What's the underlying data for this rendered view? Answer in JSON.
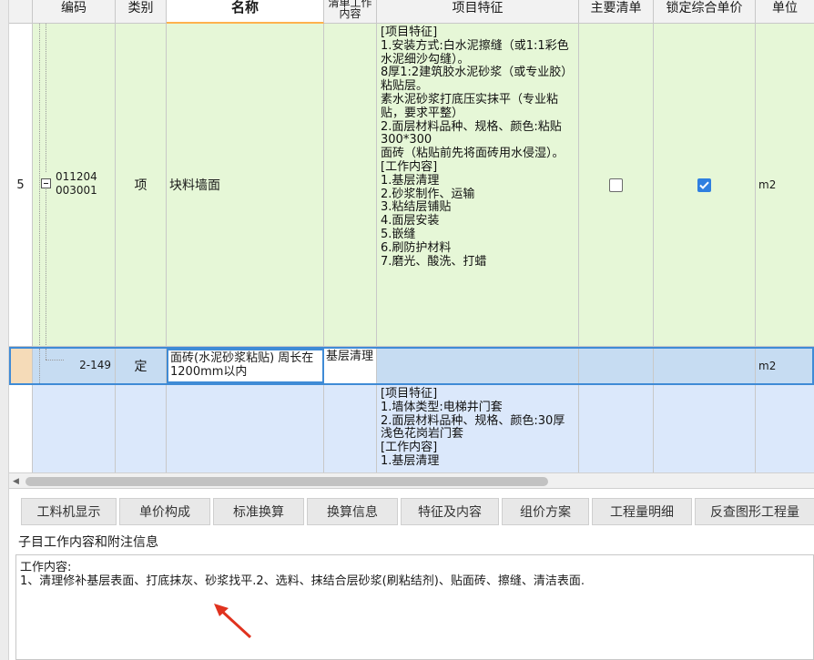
{
  "header": {
    "code": "编码",
    "type": "类别",
    "name": "名称",
    "work_content": "清单工作内容",
    "features": "项目特征",
    "main_item": "主要清单",
    "lock_price": "锁定综合单价",
    "unit": "单位"
  },
  "rows": [
    {
      "num": "5",
      "code_line1": "011204",
      "code_line2": "003001",
      "type": "项",
      "name": "块料墙面",
      "work_content": "",
      "features": "[项目特征]\n1.安装方式:白水泥擦缝（或1:1彩色水泥细沙勾缝）。\n8厚1:2建筑胶水泥砂浆（或专业胶）粘贴层。\n素水泥砂浆打底压实抹平（专业粘贴，要求平整）\n2.面层材料品种、规格、颜色:粘贴300*300\n面砖（粘贴前先将面砖用水侵湿）。\n[工作内容]\n1.基层清理\n2.砂浆制作、运输\n3.粘结层铺贴\n4.面层安装\n5.嵌缝\n6.刷防护材料\n7.磨光、酸洗、打蜡",
      "main_checked": false,
      "lock_checked": true,
      "unit": "m2"
    },
    {
      "num": "",
      "code": "2-149",
      "type": "定",
      "name": "面砖(水泥砂浆粘贴) 周长在1200mm以内",
      "work_content": "基层清理",
      "unit": "m2"
    },
    {
      "num": "",
      "features": "[项目特征]\n1.墙体类型:电梯井门套\n2.面层材料品种、规格、颜色:30厚浅色花岗岩门套\n[工作内容]\n1.基层清理"
    }
  ],
  "tabs": [
    "工料机显示",
    "单价构成",
    "标准换算",
    "换算信息",
    "特征及内容",
    "组价方案",
    "工程量明细",
    "反查图形工程量"
  ],
  "panel": {
    "title": "子目工作内容和附注信息",
    "content_label": "工作内容:",
    "content_text": "1、清理修补基层表面、打底抹灰、砂浆找平.2、选料、抹结合层砂浆(刷粘结剂)、贴面砖、擦缝、清洁表面."
  },
  "icons": {
    "collapse": "minus-box-icon",
    "checkbox": "checkbox-icon",
    "scroll_left": "scroll-left-arrow-icon",
    "annotation": "red-arrow-icon"
  },
  "colors": {
    "row_bill": "#e6f7d7",
    "row_selected": "#c6dcf2",
    "selected_border": "#3f8bd6",
    "row_next": "#dbe8fb",
    "checkbox_on": "#2f7fe0",
    "arrow": "#e0321e"
  }
}
